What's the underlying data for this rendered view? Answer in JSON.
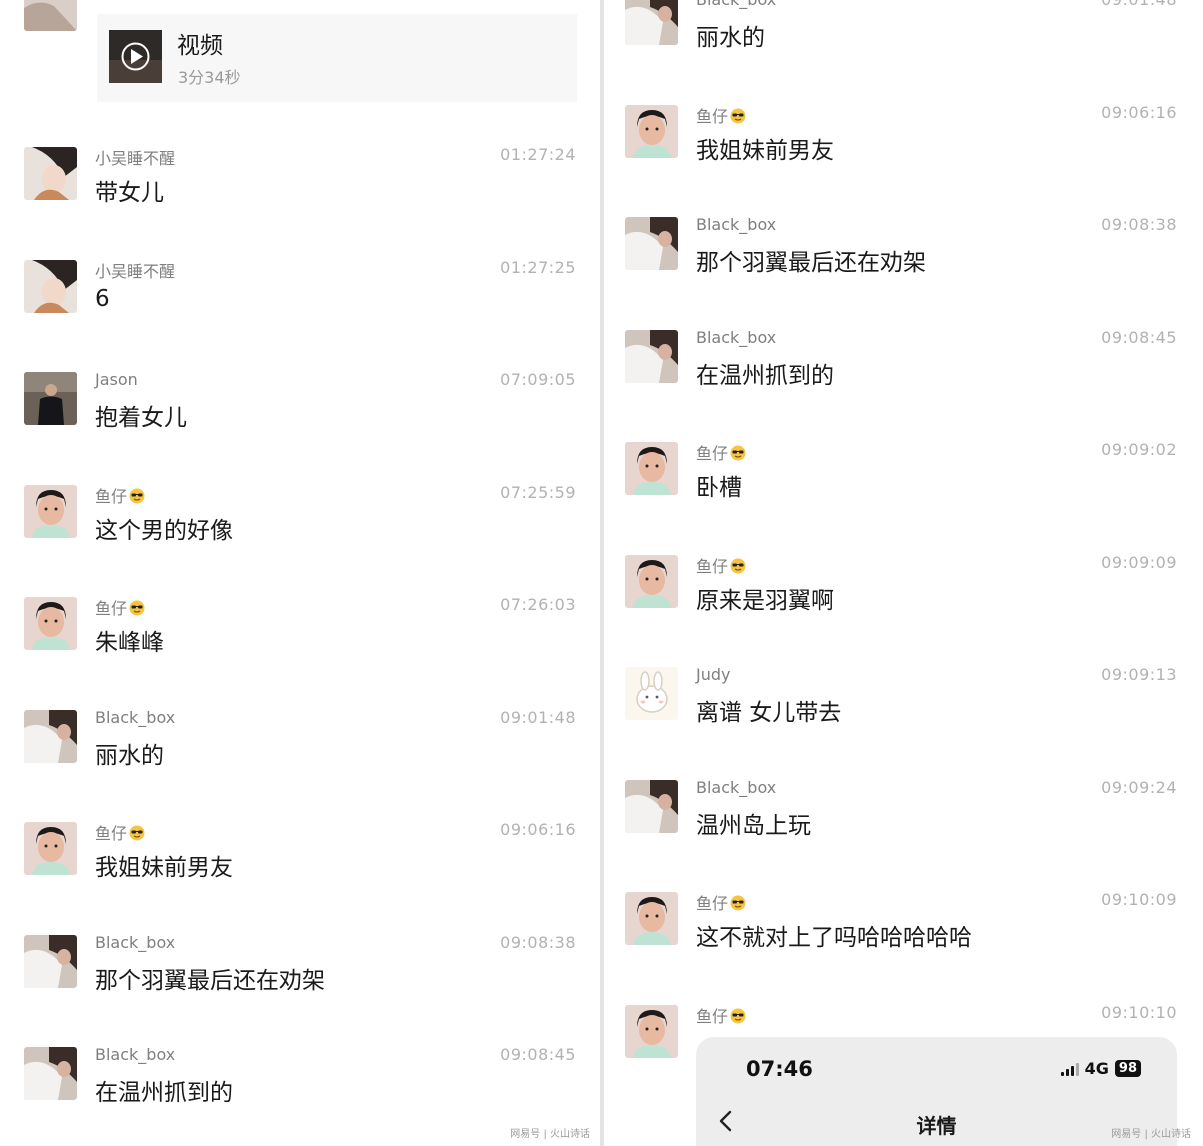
{
  "left_panel": {
    "video": {
      "title": "视频",
      "duration": "3分34秒"
    },
    "messages": [
      {
        "sender": "小吴睡不醒",
        "time": "01:27:24",
        "text": "带女儿",
        "avatar": "girl"
      },
      {
        "sender": "小吴睡不醒",
        "time": "01:27:25",
        "text": "6",
        "avatar": "girl"
      },
      {
        "sender": "Jason",
        "time": "07:09:05",
        "text": "抱着女儿",
        "avatar": "jason"
      },
      {
        "sender": "鱼仔",
        "time": "07:25:59",
        "text": "这个男的好像",
        "avatar": "boy",
        "emoji": true
      },
      {
        "sender": "鱼仔",
        "time": "07:26:03",
        "text": "朱峰峰",
        "avatar": "boy",
        "emoji": true
      },
      {
        "sender": "Black_box",
        "time": "09:01:48",
        "text": "丽水的",
        "avatar": "blackbox"
      },
      {
        "sender": "鱼仔",
        "time": "09:06:16",
        "text": "我姐妹前男友",
        "avatar": "boy",
        "emoji": true
      },
      {
        "sender": "Black_box",
        "time": "09:08:38",
        "text": "那个羽翼最后还在劝架",
        "avatar": "blackbox"
      },
      {
        "sender": "Black_box",
        "time": "09:08:45",
        "text": "在温州抓到的",
        "avatar": "blackbox"
      }
    ],
    "watermark": "网易号 | 火山诗话"
  },
  "right_panel": {
    "messages": [
      {
        "sender": "Black_box",
        "time": "09:01:48",
        "text": "丽水的",
        "avatar": "blackbox"
      },
      {
        "sender": "鱼仔",
        "time": "09:06:16",
        "text": "我姐妹前男友",
        "avatar": "boy",
        "emoji": true
      },
      {
        "sender": "Black_box",
        "time": "09:08:38",
        "text": "那个羽翼最后还在劝架",
        "avatar": "blackbox"
      },
      {
        "sender": "Black_box",
        "time": "09:08:45",
        "text": "在温州抓到的",
        "avatar": "blackbox"
      },
      {
        "sender": "鱼仔",
        "time": "09:09:02",
        "text": "卧槽",
        "avatar": "boy",
        "emoji": true
      },
      {
        "sender": "鱼仔",
        "time": "09:09:09",
        "text": "原来是羽翼啊",
        "avatar": "boy",
        "emoji": true
      },
      {
        "sender": "Judy",
        "time": "09:09:13",
        "text": "离谱  女儿带去",
        "avatar": "judy"
      },
      {
        "sender": "Black_box",
        "time": "09:09:24",
        "text": "温州岛上玩",
        "avatar": "blackbox"
      },
      {
        "sender": "鱼仔",
        "time": "09:10:09",
        "text": "这不就对上了吗哈哈哈哈哈",
        "avatar": "boy",
        "emoji": true
      },
      {
        "sender": "鱼仔",
        "time": "09:10:10",
        "text": "",
        "avatar": "boy",
        "emoji": true
      }
    ],
    "phone_overlay": {
      "time": "07:46",
      "network": "4G",
      "battery": "98",
      "title": "详情",
      "back_icon": "chevron-left-icon"
    },
    "watermark": "网易号 | 火山诗话"
  }
}
